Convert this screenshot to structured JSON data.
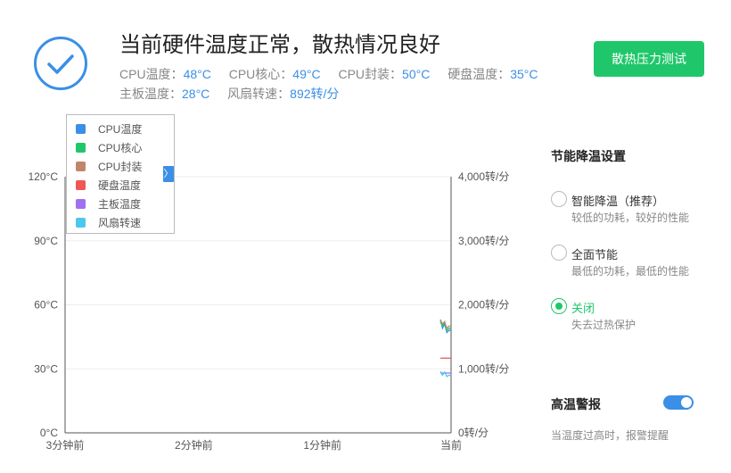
{
  "header": {
    "title": "当前硬件温度正常，散热情况良好",
    "stats": [
      {
        "label": "CPU温度：",
        "value": "48°C"
      },
      {
        "label": "CPU核心：",
        "value": "49°C"
      },
      {
        "label": "CPU封装：",
        "value": "50°C"
      },
      {
        "label": "硬盘温度：",
        "value": "35°C"
      },
      {
        "label": "主板温度：",
        "value": "28°C"
      },
      {
        "label": "风扇转速：",
        "value": "892转/分"
      }
    ],
    "stress_button": "散热压力测试",
    "status_icon": "check-circle-icon"
  },
  "legend": [
    {
      "name": "CPU温度",
      "color": "#3b8fe6"
    },
    {
      "name": "CPU核心",
      "color": "#1fc76a"
    },
    {
      "name": "CPU封装",
      "color": "#c0866a"
    },
    {
      "name": "硬盘温度",
      "color": "#f05656"
    },
    {
      "name": "主板温度",
      "color": "#a070f0"
    },
    {
      "name": "风扇转速",
      "color": "#4cc7ee"
    }
  ],
  "legend_toggle": "〉",
  "chart_data": {
    "type": "line",
    "x_ticks": [
      "3分钟前",
      "2分钟前",
      "1分钟前",
      "当前"
    ],
    "y_left_ticks": [
      "0°C",
      "30°C",
      "60°C",
      "90°C",
      "120°C"
    ],
    "y_right_ticks": [
      "0转/分",
      "1,000转/分",
      "2,000转/分",
      "3,000转/分",
      "4,000转/分"
    ],
    "ylim_left": [
      0,
      120
    ],
    "ylim_right": [
      0,
      4000
    ],
    "xlim": [
      -180,
      0
    ],
    "grid": true,
    "legend_position": "top-left",
    "series": [
      {
        "name": "CPU温度",
        "axis": "left",
        "color": "#3b8fe6",
        "x": [
          -5,
          -4,
          -3,
          -2,
          -1,
          0
        ],
        "y": [
          53,
          49,
          51,
          47,
          48,
          48
        ]
      },
      {
        "name": "CPU核心",
        "axis": "left",
        "color": "#1fc76a",
        "x": [
          -5,
          -4,
          -3,
          -2,
          -1,
          0
        ],
        "y": [
          52,
          50,
          52,
          48,
          49,
          49
        ]
      },
      {
        "name": "CPU封装",
        "axis": "left",
        "color": "#c0866a",
        "x": [
          -5,
          -4,
          -3,
          -2,
          -1,
          0
        ],
        "y": [
          53,
          51,
          52,
          49,
          50,
          50
        ]
      },
      {
        "name": "硬盘温度",
        "axis": "left",
        "color": "#f05656",
        "x": [
          -5,
          -4,
          -3,
          -2,
          -1,
          0
        ],
        "y": [
          35,
          35,
          35,
          35,
          35,
          35
        ]
      },
      {
        "name": "主板温度",
        "axis": "left",
        "color": "#a070f0",
        "x": [
          -5,
          -4,
          -3,
          -2,
          -1,
          0
        ],
        "y": [
          28,
          28,
          28,
          28,
          28,
          28
        ]
      },
      {
        "name": "风扇转速",
        "axis": "right",
        "color": "#4cc7ee",
        "x": [
          -5,
          -4,
          -3,
          -2,
          -1,
          0
        ],
        "y": [
          960,
          900,
          950,
          880,
          900,
          892
        ]
      }
    ]
  },
  "cooling": {
    "title": "节能降温设置",
    "options": [
      {
        "label": "智能降温（推荐）",
        "desc": "较低的功耗，较好的性能",
        "selected": false
      },
      {
        "label": "全面节能",
        "desc": "最低的功耗，最低的性能",
        "selected": false
      },
      {
        "label": "关闭",
        "desc": "失去过热保护",
        "selected": true
      }
    ]
  },
  "alarm": {
    "title": "高温警报",
    "enabled": true,
    "desc": "当温度过高时，报警提醒"
  }
}
